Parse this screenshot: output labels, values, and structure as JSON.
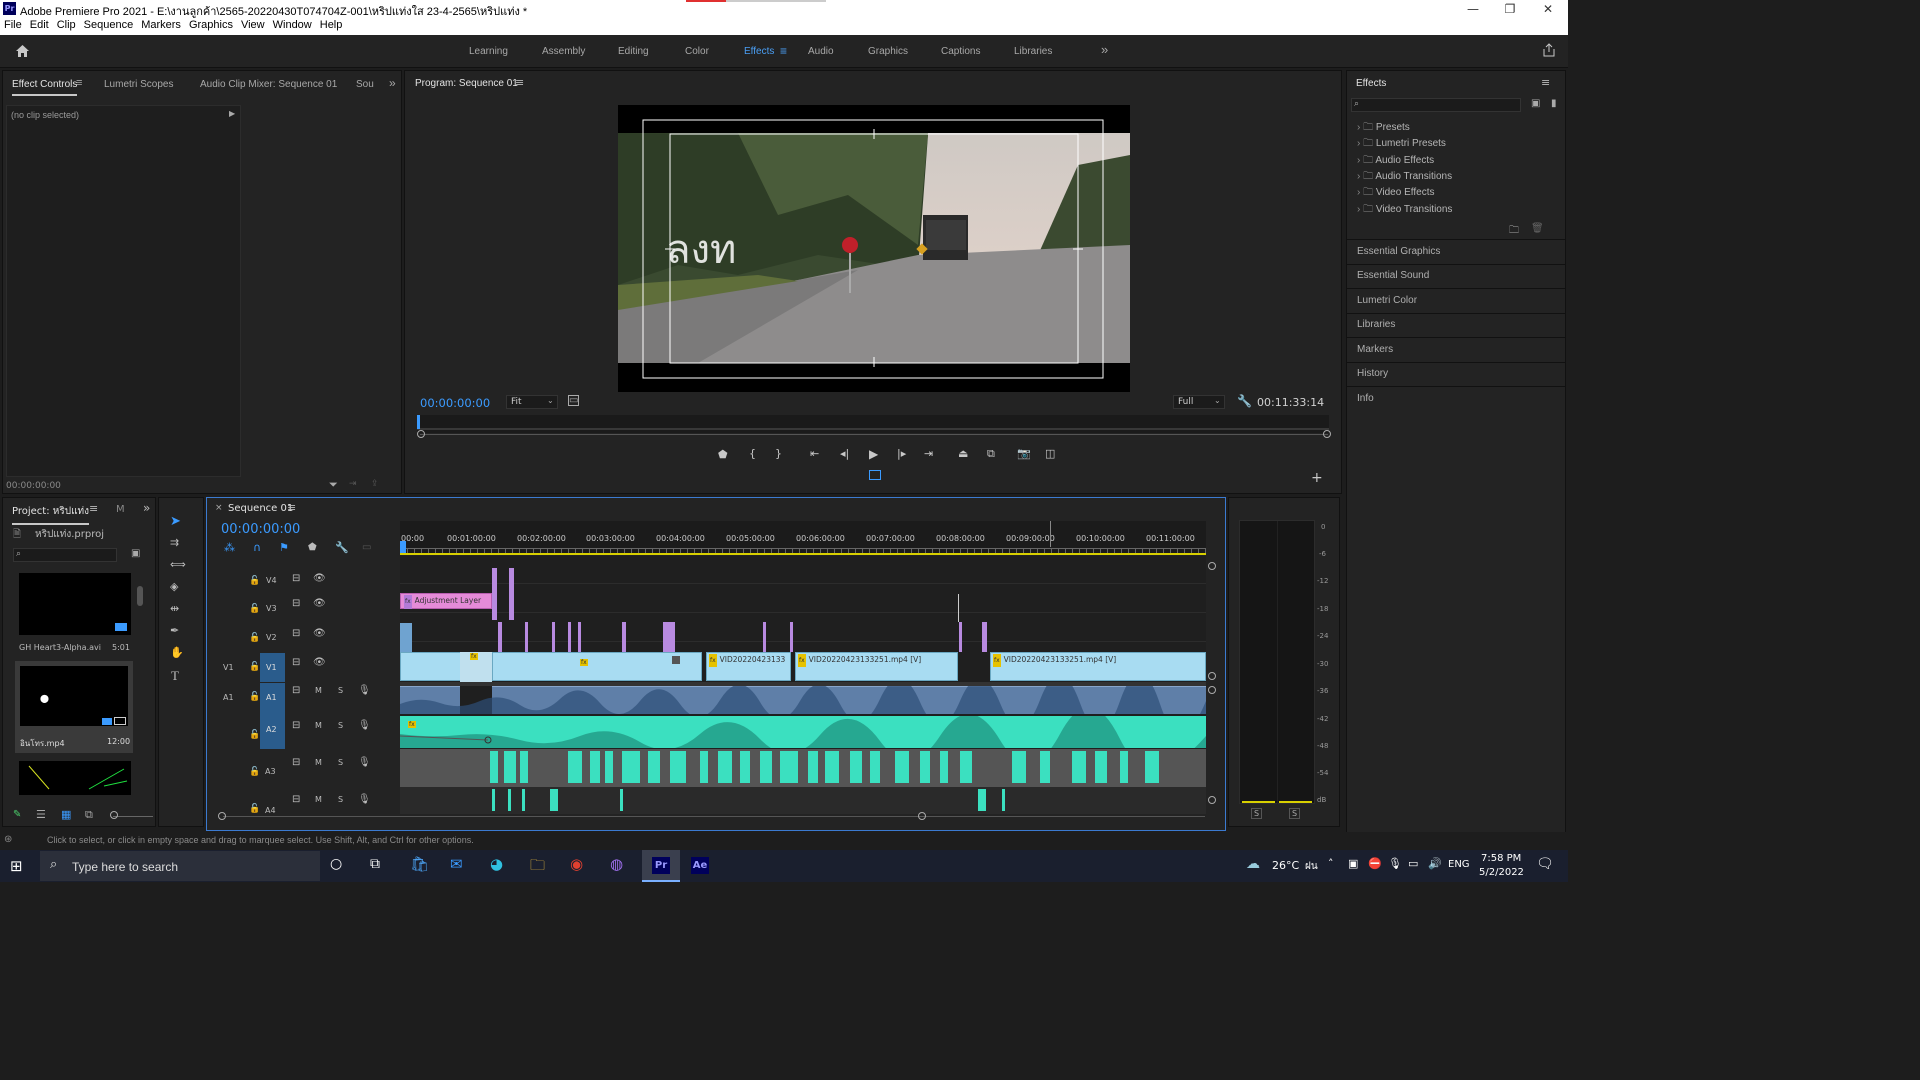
{
  "window": {
    "app_logo_text": "Pr",
    "title": "Adobe Premiere Pro 2021 - E:\\งานลูกค้า\\2565-20220430T074704Z-001\\หริปแท่งใส 23-4-2565\\หริปแท่ง *",
    "minimize": "—",
    "maximize": "❐",
    "close": "✕"
  },
  "menu": [
    "File",
    "Edit",
    "Clip",
    "Sequence",
    "Markers",
    "Graphics",
    "View",
    "Window",
    "Help"
  ],
  "workspaces": {
    "tabs": [
      "Learning",
      "Assembly",
      "Editing",
      "Color",
      "Effects",
      "Audio",
      "Graphics",
      "Captions",
      "Libraries"
    ],
    "active": "Effects",
    "overflow": "»"
  },
  "effect_controls": {
    "tabs": [
      "Effect Controls",
      "Lumetri Scopes",
      "Audio Clip Mixer: Sequence 01",
      "Sou"
    ],
    "status": "(no clip selected)",
    "timecode": "00:00:00:00"
  },
  "program": {
    "title": "Program: Sequence 01",
    "timecode": "00:00:00:00",
    "fit": "Fit",
    "quality": "Full",
    "duration": "00:11:33:14",
    "overlay_text": "ลงท"
  },
  "effects_panel": {
    "title": "Effects",
    "folders": [
      "Presets",
      "Lumetri Presets",
      "Audio Effects",
      "Audio Transitions",
      "Video Effects",
      "Video Transitions"
    ],
    "side_panels": [
      "Essential Graphics",
      "Essential Sound",
      "Lumetri Color",
      "Libraries",
      "Markers",
      "History",
      "Info"
    ]
  },
  "project": {
    "tabs": [
      "Project: หริปแท่ง",
      "M"
    ],
    "file": "หริปแท่ง.prproj",
    "items": [
      {
        "name": "GH Heart3-Alpha.avi",
        "duration": "5:01"
      },
      {
        "name": "อินโทร.mp4",
        "duration": "12:00"
      }
    ]
  },
  "timeline": {
    "sequence_name": "Sequence 01",
    "timecode": "00:00:00:00",
    "ruler": [
      "00:00",
      "00:01:00:00",
      "00:02:00:00",
      "00:03:00:00",
      "00:04:00:00",
      "00:05:00:00",
      "00:06:00:00",
      "00:07:00:00",
      "00:08:00:00",
      "00:09:00:00",
      "00:10:00:00",
      "00:11:00:00"
    ],
    "video_tracks": [
      "V4",
      "V3",
      "V2",
      "V1"
    ],
    "audio_tracks": [
      "A1",
      "A2",
      "A3",
      "A4"
    ],
    "source_patch_v": "V1",
    "source_patch_a": "A1",
    "adjustment_layer": "Adjustment Layer",
    "clip_labels": [
      "VID20220423133",
      "VID20220423133251.mp4 [V]",
      "VID20220423133251.mp4 [V]"
    ],
    "track_btn_m": "M",
    "track_btn_s": "S"
  },
  "meter": {
    "scale": [
      "0",
      "-6",
      "-12",
      "-18",
      "-24",
      "-30",
      "-36",
      "-42",
      "-48",
      "-54",
      "dB"
    ],
    "solo": [
      "S",
      "S"
    ]
  },
  "status_bar": {
    "text": "Click to select, or click in empty space and drag to marquee select. Use Shift, Alt, and Ctrl for other options."
  },
  "taskbar": {
    "search_placeholder": "Type here to search",
    "weather": "26°C",
    "weather_extra": "ฝน",
    "lang": "ENG",
    "time": "7:58 PM",
    "date": "5/2/2022",
    "pr_label": "Pr",
    "ae_label": "Ae"
  },
  "colors": {
    "accent": "#3b9bff",
    "video_clip": "#a8dcf2",
    "audio_clip": "#5f7fa8",
    "audio_green": "#3be0c0",
    "adjustment": "#e58bd8"
  }
}
